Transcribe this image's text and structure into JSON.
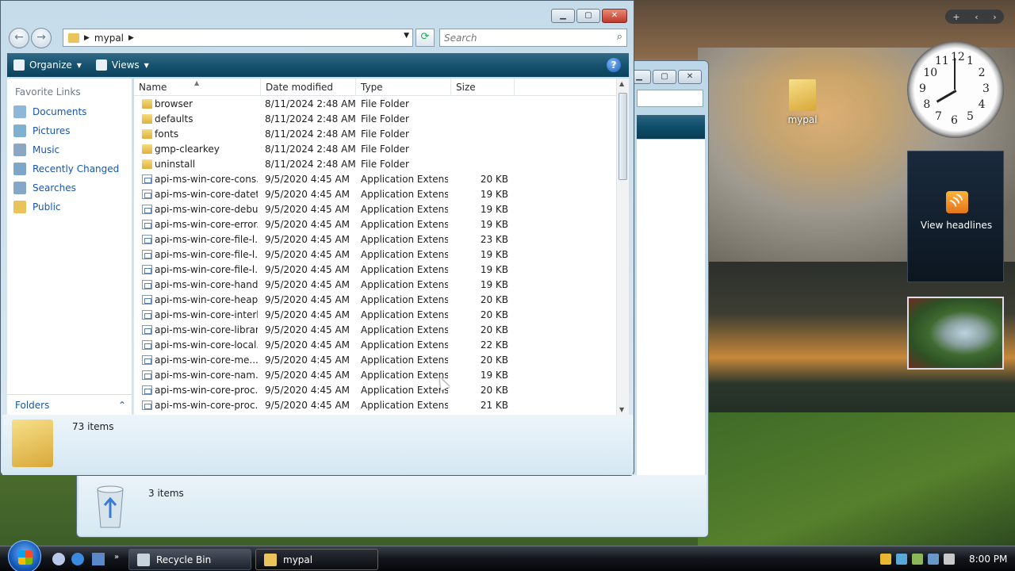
{
  "main_window": {
    "address": {
      "crumbs": [
        "mypal"
      ]
    },
    "search": {
      "placeholder": "Search"
    },
    "toolbar": {
      "organize": "Organize",
      "views": "Views"
    },
    "nav": {
      "header": "Favorite Links",
      "links": [
        "Documents",
        "Pictures",
        "Music",
        "Recently Changed",
        "Searches",
        "Public"
      ],
      "folders_label": "Folders"
    },
    "columns": [
      "Name",
      "Date modified",
      "Type",
      "Size"
    ],
    "rows": [
      {
        "name": "browser",
        "date": "8/11/2024 2:48 AM",
        "type": "File Folder",
        "size": "",
        "kind": "folder"
      },
      {
        "name": "defaults",
        "date": "8/11/2024 2:48 AM",
        "type": "File Folder",
        "size": "",
        "kind": "folder"
      },
      {
        "name": "fonts",
        "date": "8/11/2024 2:48 AM",
        "type": "File Folder",
        "size": "",
        "kind": "folder"
      },
      {
        "name": "gmp-clearkey",
        "date": "8/11/2024 2:48 AM",
        "type": "File Folder",
        "size": "",
        "kind": "folder"
      },
      {
        "name": "uninstall",
        "date": "8/11/2024 2:48 AM",
        "type": "File Folder",
        "size": "",
        "kind": "folder"
      },
      {
        "name": "api-ms-win-core-cons...",
        "date": "9/5/2020 4:45 AM",
        "type": "Application Extens...",
        "size": "20 KB",
        "kind": "dll"
      },
      {
        "name": "api-ms-win-core-datet...",
        "date": "9/5/2020 4:45 AM",
        "type": "Application Extens...",
        "size": "19 KB",
        "kind": "dll"
      },
      {
        "name": "api-ms-win-core-debu...",
        "date": "9/5/2020 4:45 AM",
        "type": "Application Extens...",
        "size": "19 KB",
        "kind": "dll"
      },
      {
        "name": "api-ms-win-core-error...",
        "date": "9/5/2020 4:45 AM",
        "type": "Application Extens...",
        "size": "19 KB",
        "kind": "dll"
      },
      {
        "name": "api-ms-win-core-file-l...",
        "date": "9/5/2020 4:45 AM",
        "type": "Application Extens...",
        "size": "23 KB",
        "kind": "dll"
      },
      {
        "name": "api-ms-win-core-file-l...",
        "date": "9/5/2020 4:45 AM",
        "type": "Application Extens...",
        "size": "19 KB",
        "kind": "dll"
      },
      {
        "name": "api-ms-win-core-file-l...",
        "date": "9/5/2020 4:45 AM",
        "type": "Application Extens...",
        "size": "19 KB",
        "kind": "dll"
      },
      {
        "name": "api-ms-win-core-hand...",
        "date": "9/5/2020 4:45 AM",
        "type": "Application Extens...",
        "size": "19 KB",
        "kind": "dll"
      },
      {
        "name": "api-ms-win-core-heap...",
        "date": "9/5/2020 4:45 AM",
        "type": "Application Extens...",
        "size": "20 KB",
        "kind": "dll"
      },
      {
        "name": "api-ms-win-core-interl...",
        "date": "9/5/2020 4:45 AM",
        "type": "Application Extens...",
        "size": "20 KB",
        "kind": "dll"
      },
      {
        "name": "api-ms-win-core-librar...",
        "date": "9/5/2020 4:45 AM",
        "type": "Application Extens...",
        "size": "20 KB",
        "kind": "dll"
      },
      {
        "name": "api-ms-win-core-local...",
        "date": "9/5/2020 4:45 AM",
        "type": "Application Extens...",
        "size": "22 KB",
        "kind": "dll"
      },
      {
        "name": "api-ms-win-core-me...",
        "date": "9/5/2020 4:45 AM",
        "type": "Application Extens...",
        "size": "20 KB",
        "kind": "dll"
      },
      {
        "name": "api-ms-win-core-nam...",
        "date": "9/5/2020 4:45 AM",
        "type": "Application Extens...",
        "size": "19 KB",
        "kind": "dll"
      },
      {
        "name": "api-ms-win-core-proc...",
        "date": "9/5/2020 4:45 AM",
        "type": "Application Extens...",
        "size": "20 KB",
        "kind": "dll"
      },
      {
        "name": "api-ms-win-core-proc...",
        "date": "9/5/2020 4:45 AM",
        "type": "Application Extens...",
        "size": "21 KB",
        "kind": "dll"
      }
    ],
    "status": {
      "count": "73 items"
    }
  },
  "back_window": {
    "status": {
      "count": "3 items"
    }
  },
  "desktop": {
    "folder_label": "mypal",
    "feed_label": "View headlines",
    "clock_numbers": [
      "12",
      "1",
      "2",
      "3",
      "4",
      "5",
      "6",
      "7",
      "8",
      "9",
      "10",
      "11"
    ],
    "clock_time": {
      "hour": 8,
      "minute": 0
    }
  },
  "taskbar": {
    "buttons": [
      "Recycle Bin",
      "mypal"
    ],
    "time": "8:00 PM"
  },
  "colors": {
    "command_bar": "#16526f",
    "link": "#1a56a8",
    "folder": "#e8c45a"
  }
}
